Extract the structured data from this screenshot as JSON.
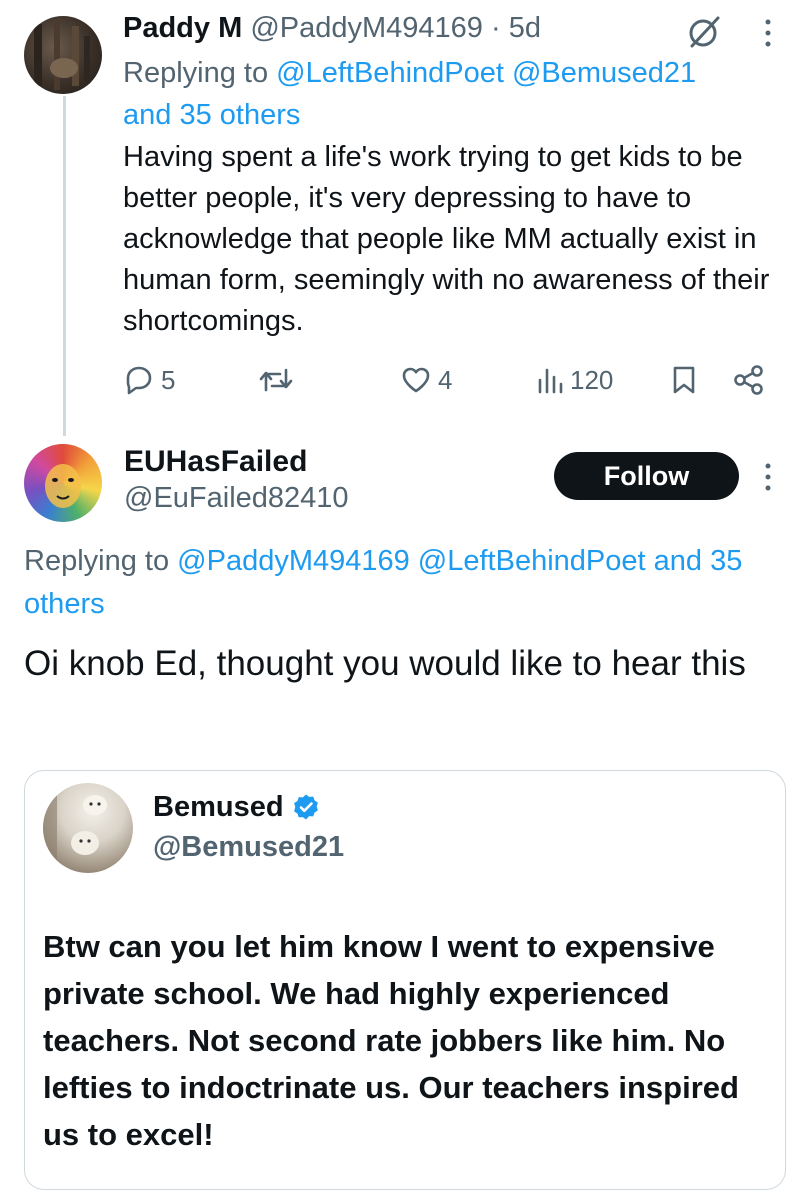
{
  "tweet1": {
    "name": "Paddy M",
    "handle": "@PaddyM494169",
    "separator": " · ",
    "time": "5d",
    "replying_prefix": "Replying to ",
    "reply_mentions": "@LeftBehindPoet @Bemused21",
    "reply_others": "and 35 others",
    "body": "Having spent a life's work trying to get kids to be better people, it's very depressing to have to acknowledge that people like MM actually exist in human form, seemingly with no awareness of their shortcomings.",
    "actions": {
      "replies": "5",
      "likes": "4",
      "views": "120"
    }
  },
  "tweet2": {
    "name": "EUHasFailed",
    "handle": "@EuFailed82410",
    "follow_label": "Follow",
    "replying_prefix": "Replying to ",
    "reply_mentions": "@PaddyM494169 @LeftBehindPoet and 35",
    "reply_others": "others",
    "body": "Oi knob Ed, thought you would like to hear this"
  },
  "quote": {
    "name": "Bemused",
    "handle": "@Bemused21",
    "body": "Btw can you let him know I went to expensive private school. We had highly experienced teachers. Not second rate jobbers like him. No lefties to indoctrinate us. Our teachers inspired us to excel!"
  },
  "icons": {
    "reply": "reply-icon",
    "repost": "repost-icon",
    "like": "heart-icon",
    "views": "views-icon",
    "bookmark": "bookmark-icon",
    "share": "share-icon",
    "grok": "grok-icon",
    "more": "more-vertical-icon",
    "verified": "verified-badge-icon"
  },
  "colors": {
    "link": "#1d9bf0",
    "muted": "#536471",
    "text": "#0f1419",
    "follow_bg": "#0f1419"
  }
}
